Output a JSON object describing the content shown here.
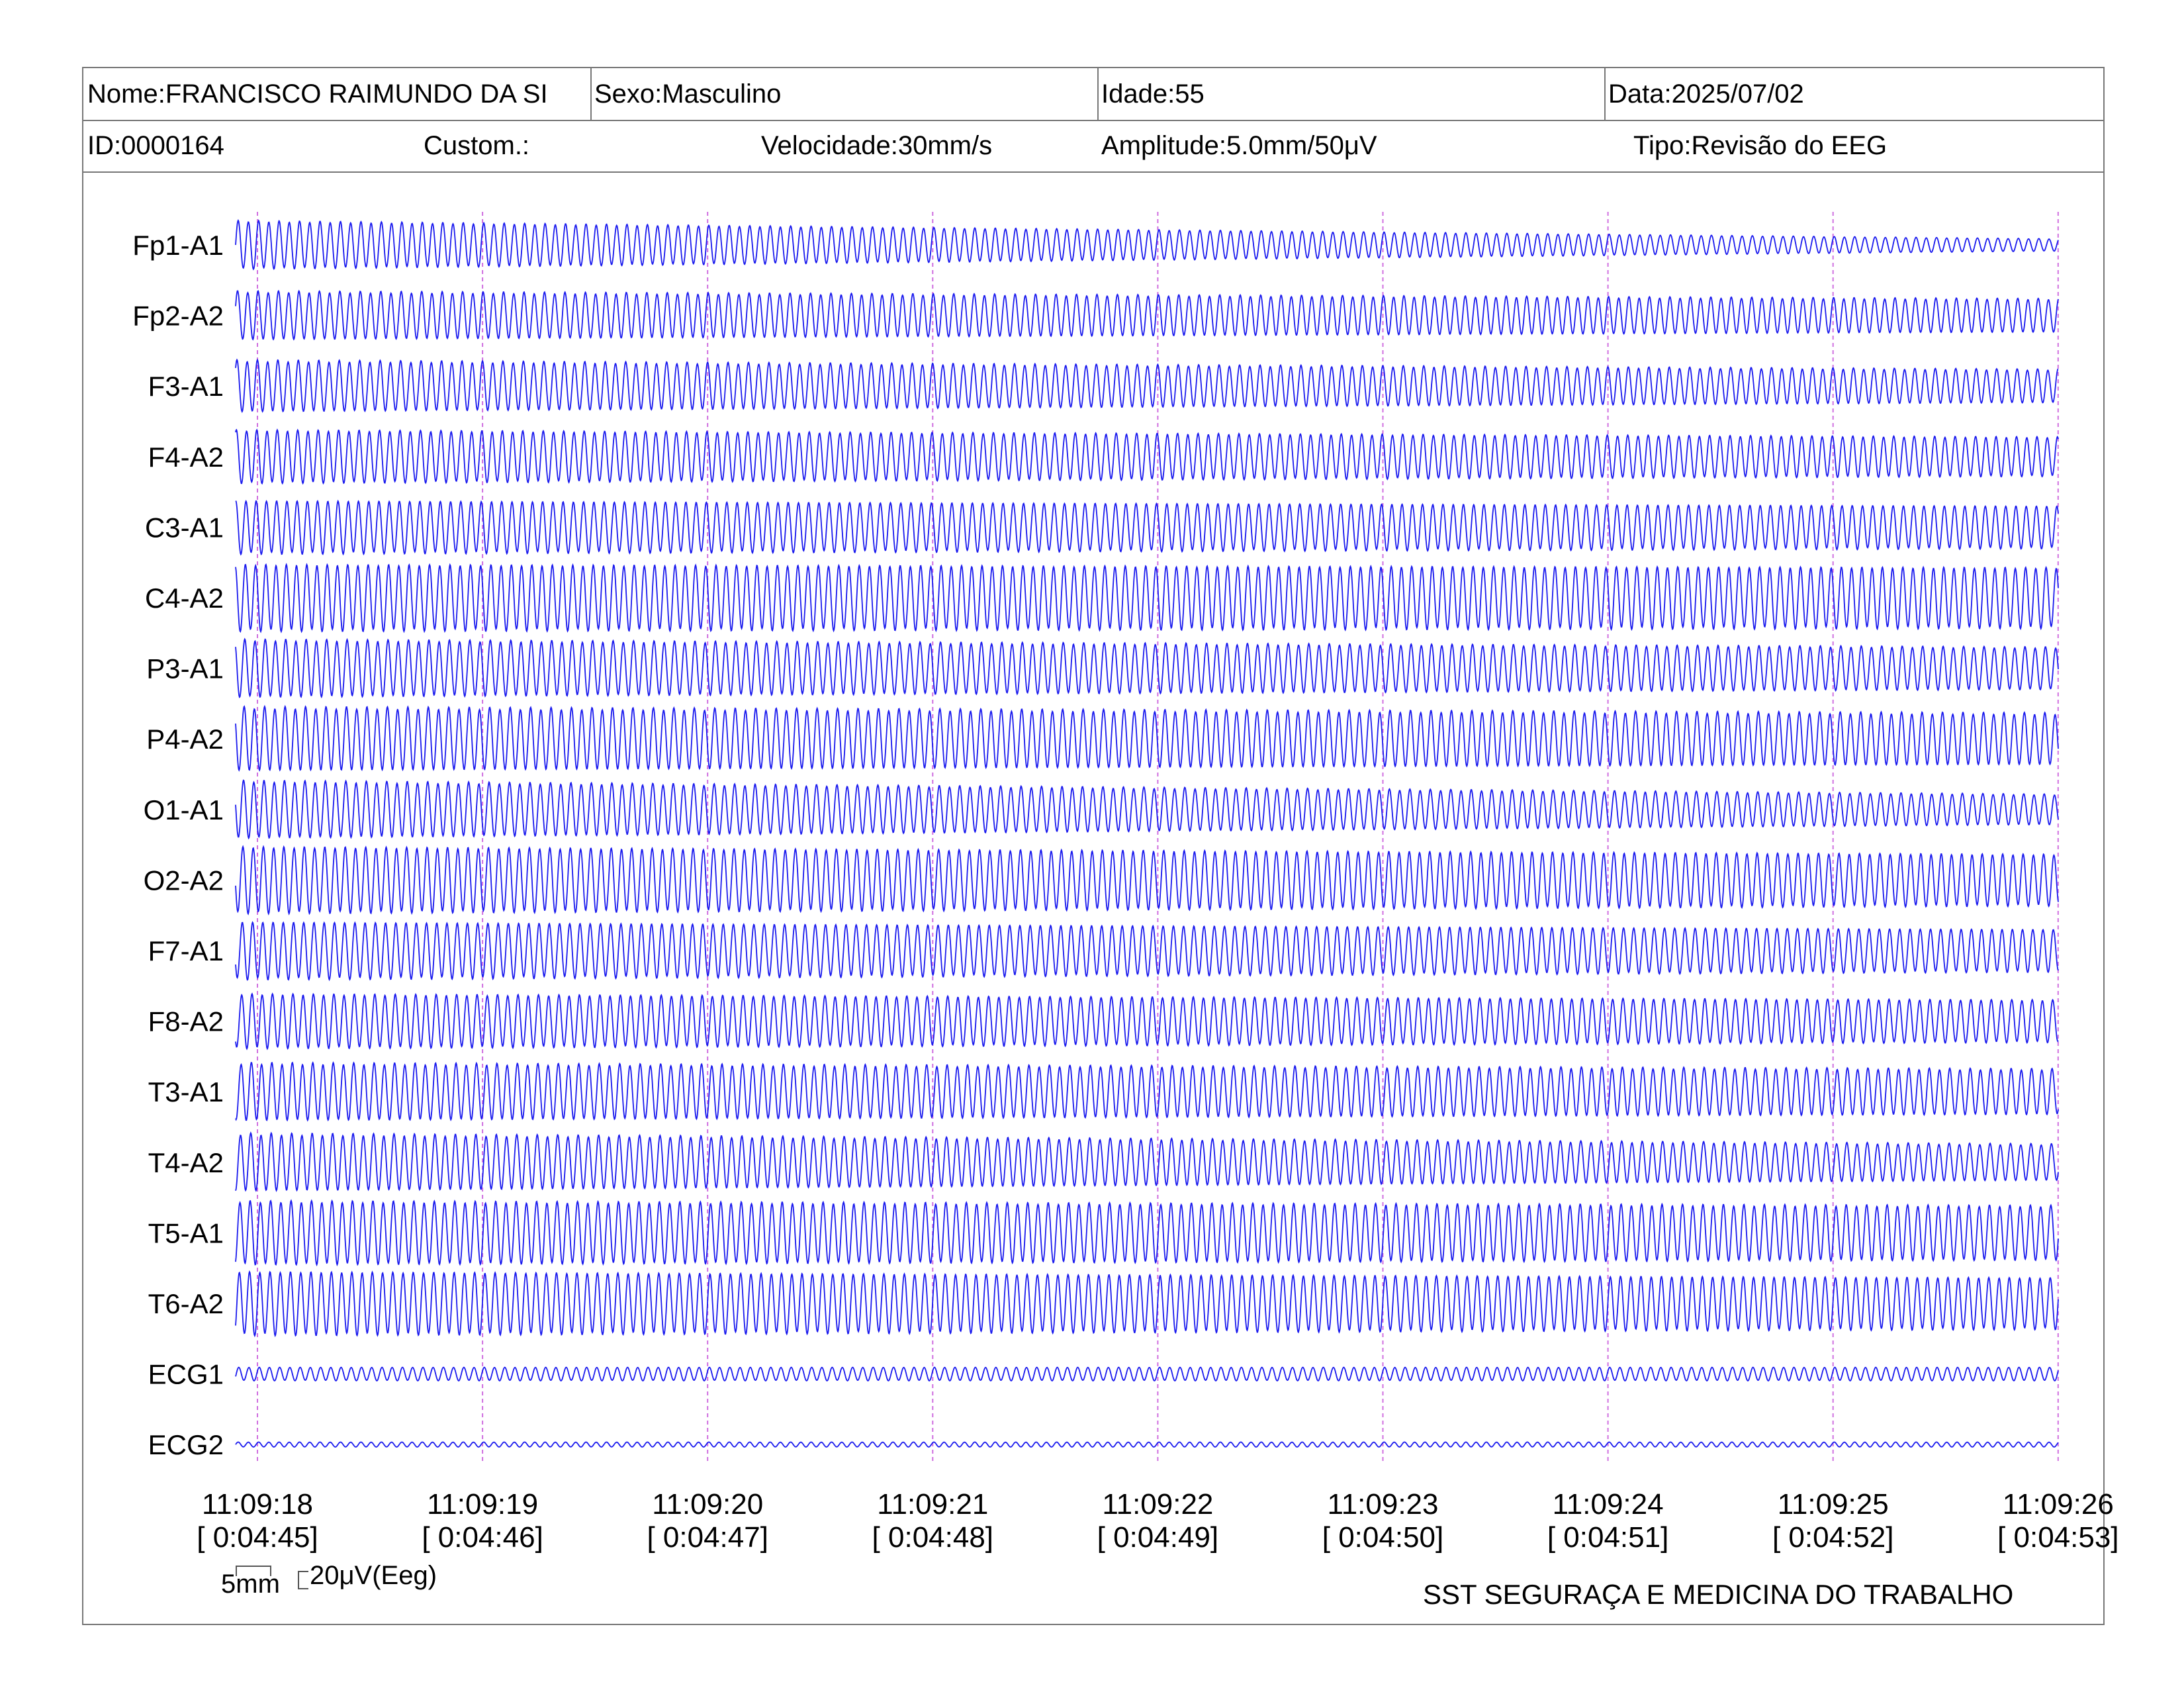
{
  "header": {
    "nome": "Nome:FRANCISCO RAIMUNDO DA SI",
    "sexo": "Sexo:Masculino",
    "idade": "Idade:55",
    "data": "Data:2025/07/02",
    "id": "ID:0000164",
    "custom": "Custom.:",
    "velocidade": "Velocidade:30mm/s",
    "amplitude": "Amplitude:5.0mm/50μV",
    "tipo": "Tipo:Revisão do EEG"
  },
  "colors": {
    "trace": "#1a1aee",
    "marker": "#d070e0",
    "border": "#777777"
  },
  "chart_data": {
    "type": "line",
    "channels": [
      "Fp1-A1",
      "Fp2-A2",
      "F3-A1",
      "F4-A2",
      "C3-A1",
      "C4-A2",
      "P3-A1",
      "P4-A2",
      "O1-A1",
      "O2-A2",
      "F7-A1",
      "F8-A2",
      "T3-A1",
      "T4-A2",
      "T5-A1",
      "T6-A2",
      "ECG1",
      "ECG2"
    ],
    "time_labels": [
      "11:09:18",
      "11:09:19",
      "11:09:20",
      "11:09:21",
      "11:09:22",
      "11:09:23",
      "11:09:24",
      "11:09:25",
      "11:09:26"
    ],
    "elapsed_labels": [
      "[ 0:04:45]",
      "[ 0:04:46]",
      "[ 0:04:47]",
      "[ 0:04:48]",
      "[ 0:04:49]",
      "[ 0:04:50]",
      "[ 0:04:51]",
      "[ 0:04:52]",
      "[ 0:04:53]"
    ],
    "peak_to_peak_uV": {
      "Fp1-A1": [
        80,
        20
      ],
      "Fp2-A2": [
        80,
        55
      ],
      "F3-A1": [
        85,
        55
      ],
      "F4-A2": [
        88,
        65
      ],
      "C3-A1": [
        88,
        70
      ],
      "C4-A2": [
        110,
        100
      ],
      "P3-A1": [
        95,
        70
      ],
      "P4-A2": [
        105,
        85
      ],
      "O1-A1": [
        95,
        50
      ],
      "O2-A2": [
        110,
        85
      ],
      "F7-A1": [
        95,
        70
      ],
      "F8-A2": [
        90,
        70
      ],
      "T3-A1": [
        95,
        75
      ],
      "T4-A2": [
        95,
        60
      ],
      "T5-A1": [
        105,
        90
      ],
      "T6-A2": [
        105,
        85
      ],
      "ECG1": [
        22,
        22
      ],
      "ECG2": [
        8,
        8
      ]
    },
    "cycles_per_second": 22,
    "grid": "vertical second markers",
    "legend": "none"
  },
  "scale": {
    "time_label": "5mm",
    "amp_label": "20μV(Eeg)"
  },
  "footer": {
    "company": "SST SEGURAÇA E MEDICINA DO TRABALHO"
  }
}
